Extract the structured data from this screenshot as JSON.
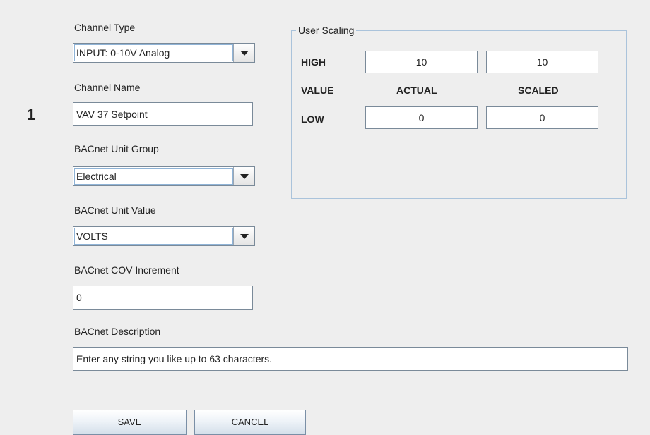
{
  "channel": {
    "number": "1"
  },
  "channel_type": {
    "label": "Channel Type",
    "value": "INPUT: 0-10V Analog"
  },
  "channel_name": {
    "label": "Channel Name",
    "value": "VAV 37 Setpoint"
  },
  "unit_group": {
    "label": "BACnet Unit Group",
    "value": "Electrical"
  },
  "unit_value": {
    "label": "BACnet Unit Value",
    "value": "VOLTS"
  },
  "cov_increment": {
    "label": "BACnet COV Increment",
    "value": "0"
  },
  "description": {
    "label": "BACnet Description",
    "value": "Enter any string you like up to 63 characters."
  },
  "user_scaling": {
    "title": "User Scaling",
    "high_label": "HIGH",
    "value_label": "VALUE",
    "low_label": "LOW",
    "actual_header": "ACTUAL",
    "scaled_header": "SCALED",
    "high_actual": "10",
    "high_scaled": "10",
    "low_actual": "0",
    "low_scaled": "0"
  },
  "buttons": {
    "save": "SAVE",
    "cancel": "CANCEL"
  },
  "icons": {
    "dropdown": "chevron-down-icon"
  }
}
